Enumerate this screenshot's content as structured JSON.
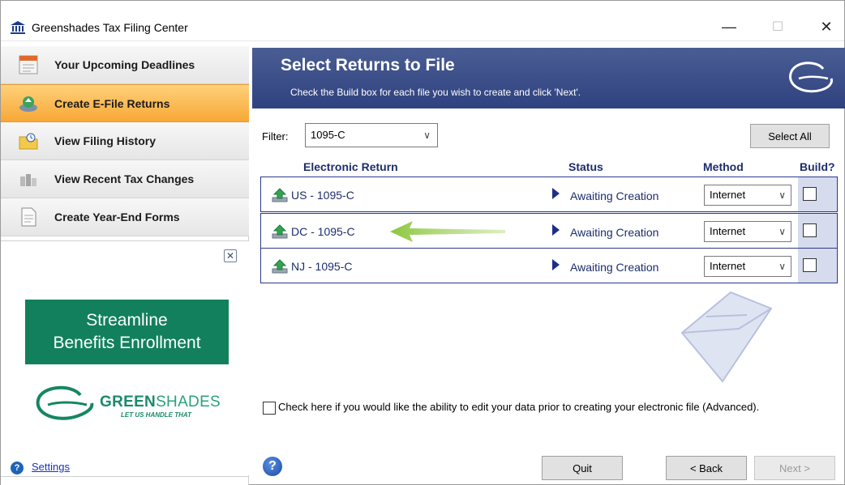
{
  "window": {
    "title": "Greenshades Tax Filing Center",
    "minimize_glyph": "—",
    "maximize_glyph": "☐",
    "close_glyph": "✕"
  },
  "sidebar": {
    "items": [
      {
        "label": "Your Upcoming Deadlines",
        "icon": "calendar-icon",
        "active": false
      },
      {
        "label": "Create E-File Returns",
        "icon": "efile-icon",
        "active": true
      },
      {
        "label": "View Filing History",
        "icon": "folder-icon",
        "active": false
      },
      {
        "label": "View Recent Tax Changes",
        "icon": "coins-icon",
        "active": false
      },
      {
        "label": "Create Year-End Forms",
        "icon": "document-icon",
        "active": false
      }
    ],
    "ad": {
      "close_glyph": "✕",
      "line1": "Streamline",
      "line2": "Benefits Enrollment",
      "brand_bold": "GREEN",
      "brand_light": "SHADES",
      "brand_tagline": "LET US HANDLE THAT"
    },
    "settings_label": "Settings",
    "help_glyph": "?"
  },
  "header": {
    "title": "Select Returns to File",
    "subtitle": "Check the Build box for each file you wish to create and click 'Next'."
  },
  "filter": {
    "label": "Filter:",
    "value": "1095-C"
  },
  "select_all_label": "Select All",
  "columns": {
    "return": "Electronic Return",
    "status": "Status",
    "method": "Method",
    "build": "Build?"
  },
  "returns": [
    {
      "name": "US - 1095-C",
      "status": "Awaiting Creation",
      "method": "Internet",
      "build": false
    },
    {
      "name": "DC - 1095-C",
      "status": "Awaiting Creation",
      "method": "Internet",
      "build": false
    },
    {
      "name": "NJ - 1095-C",
      "status": "Awaiting Creation",
      "method": "Internet",
      "build": false
    }
  ],
  "advanced_option": {
    "label": "Check here if you would like the ability to edit your data prior to creating your electronic file (Advanced).",
    "checked": false
  },
  "buttons": {
    "help_glyph": "?",
    "quit": "Quit",
    "back": "< Back",
    "next": "Next >"
  },
  "colors": {
    "accent_orange": "#f7a836",
    "header_blue": "#2f4280",
    "brand_green": "#12805c",
    "arrow_green": "#8cc63f"
  }
}
